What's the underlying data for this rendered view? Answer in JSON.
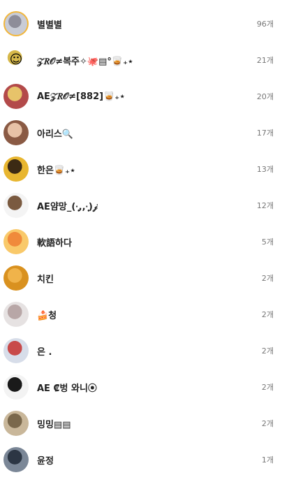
{
  "rows": [
    {
      "name": "별별별",
      "count": "96개",
      "avatar_icon": "cat-photo",
      "bg": "#c9ccd6",
      "accent": "#8e8d99",
      "glyph": "",
      "ring": true
    },
    {
      "name": "𝒵𝑅𝒪≠복주✧🐙▤°🥃₊⋆",
      "count": "21개",
      "avatar_icon": "cartoon-character",
      "bg": "#ffffff",
      "accent": "#d6b84a",
      "glyph": "☺",
      "ring": false
    },
    {
      "name": "AE𝒵𝑅𝒪≠[882]🥃₊⋆",
      "count": "20개",
      "avatar_icon": "group-photo",
      "bg": "#b34a4a",
      "accent": "#e7c36a",
      "glyph": "",
      "ring": false
    },
    {
      "name": "아리스🔍",
      "count": "17개",
      "avatar_icon": "person-photo",
      "bg": "#8a5a44",
      "accent": "#e7c2a7",
      "glyph": "",
      "ring": false
    },
    {
      "name": "한은🥃₊⋆",
      "count": "13개",
      "avatar_icon": "pikachu-character",
      "bg": "#e8b630",
      "accent": "#3c2a14",
      "glyph": "",
      "ring": false
    },
    {
      "name": "AE얌망_(·̩̩̥͙,,·̩̩̥͙)𝒿",
      "count": "12개",
      "avatar_icon": "cartoon-figure",
      "bg": "#f4f4f4",
      "accent": "#7a5a40",
      "glyph": "",
      "ring": false
    },
    {
      "name": "軟語하다",
      "count": "5개",
      "avatar_icon": "cartoon-girl",
      "bg": "#f9c96a",
      "accent": "#f08a3b",
      "glyph": "",
      "ring": false
    },
    {
      "name": "치킨",
      "count": "2개",
      "avatar_icon": "fried-chicken-photo",
      "bg": "#d9911f",
      "accent": "#f0b34a",
      "glyph": "",
      "ring": false
    },
    {
      "name": "🍰청",
      "count": "2개",
      "avatar_icon": "cat-photo",
      "bg": "#e6e2e2",
      "accent": "#b8a7a7",
      "glyph": "",
      "ring": false
    },
    {
      "name": "은 .",
      "count": "2개",
      "avatar_icon": "photo",
      "bg": "#d7dde9",
      "accent": "#c84a4a",
      "glyph": "",
      "ring": false
    },
    {
      "name": "AE ₡벙 와니⦿",
      "count": "2개",
      "avatar_icon": "cartoon-character",
      "bg": "#f3f3f3",
      "accent": "#1a1a1a",
      "glyph": "",
      "ring": false
    },
    {
      "name": "밍밍▤▤",
      "count": "2개",
      "avatar_icon": "cat-photo",
      "bg": "#c9b79a",
      "accent": "#7a684c",
      "glyph": "",
      "ring": false
    },
    {
      "name": "윤정",
      "count": "1개",
      "avatar_icon": "person-photo",
      "bg": "#7b8797",
      "accent": "#2c3644",
      "glyph": "",
      "ring": false
    }
  ]
}
